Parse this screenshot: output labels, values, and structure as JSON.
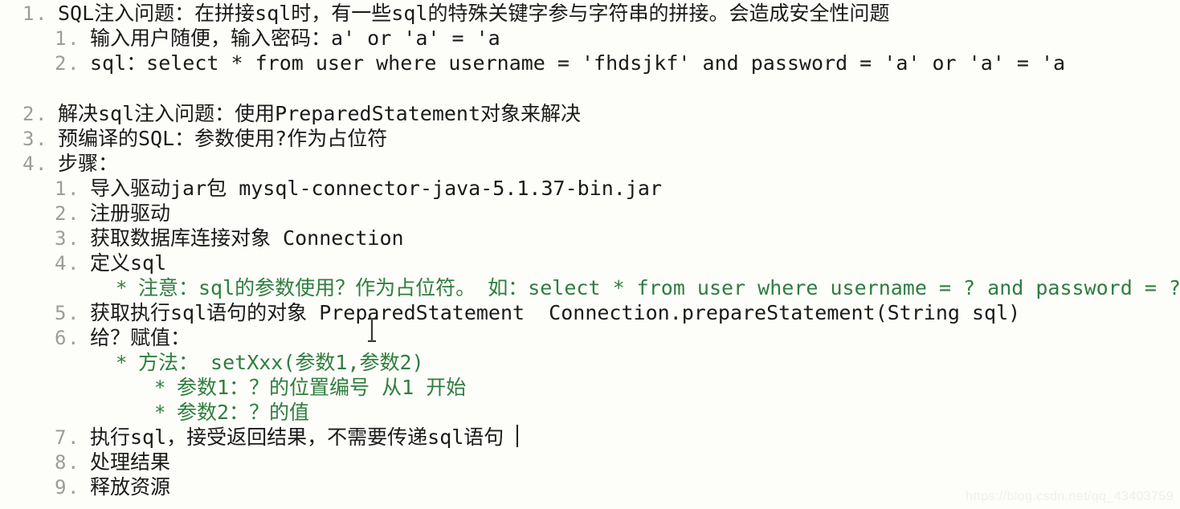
{
  "document": {
    "background_color": "#fdfdfa",
    "text_color": "#1a1a1a",
    "marker_color": "#9c9c98",
    "accent_color": "#2f7d3f",
    "watermark": "https://blog.csdn.net/qq_43403759"
  },
  "outline": {
    "item1": {
      "marker": "1.",
      "text": "SQL注入问题：在拼接sql时，有一些sql的特殊关键字参与字符串的拼接。会造成安全性问题",
      "children": [
        {
          "marker": "1.",
          "text": "输入用户随便，输入密码：a' or 'a' = 'a"
        },
        {
          "marker": "2.",
          "text": "sql：select * from user where username = 'fhdsjkf' and password = 'a' or 'a' = 'a"
        }
      ]
    },
    "item2": {
      "marker": "2.",
      "text": "解决sql注入问题：使用PreparedStatement对象来解决"
    },
    "item3": {
      "marker": "3.",
      "text": "预编译的SQL：参数使用?作为占位符"
    },
    "item4": {
      "marker": "4.",
      "text": "步骤：",
      "children": [
        {
          "marker": "1.",
          "text": "导入驱动jar包 mysql-connector-java-5.1.37-bin.jar"
        },
        {
          "marker": "2.",
          "text": "注册驱动"
        },
        {
          "marker": "3.",
          "text": "获取数据库连接对象 Connection"
        },
        {
          "marker": "4.",
          "text": "定义sql"
        },
        {
          "marker": "*",
          "text": "注意：sql的参数使用？作为占位符。 如：select * from user where username = ? and password = ?;",
          "highlight": true
        },
        {
          "marker": "5.",
          "text": "获取执行sql语句的对象 PreparedStatement  Connection.prepareStatement(String sql)"
        },
        {
          "marker": "6.",
          "text": "给？赋值："
        },
        {
          "marker": "*",
          "text": "方法： setXxx(参数1,参数2)",
          "highlight": true
        },
        {
          "marker": "*",
          "text": "参数1：？的位置编号 从1 开始",
          "highlight": true
        },
        {
          "marker": "*",
          "text": "参数2：？的值",
          "highlight": true
        },
        {
          "marker": "7.",
          "text": "执行sql，接受返回结果，不需要传递sql语句"
        },
        {
          "marker": "8.",
          "text": "处理结果"
        },
        {
          "marker": "9.",
          "text": "释放资源"
        }
      ]
    }
  },
  "cursor": {
    "mouse_pointer_icon": "text-ibeam-cursor",
    "text_caret_visible": true
  }
}
